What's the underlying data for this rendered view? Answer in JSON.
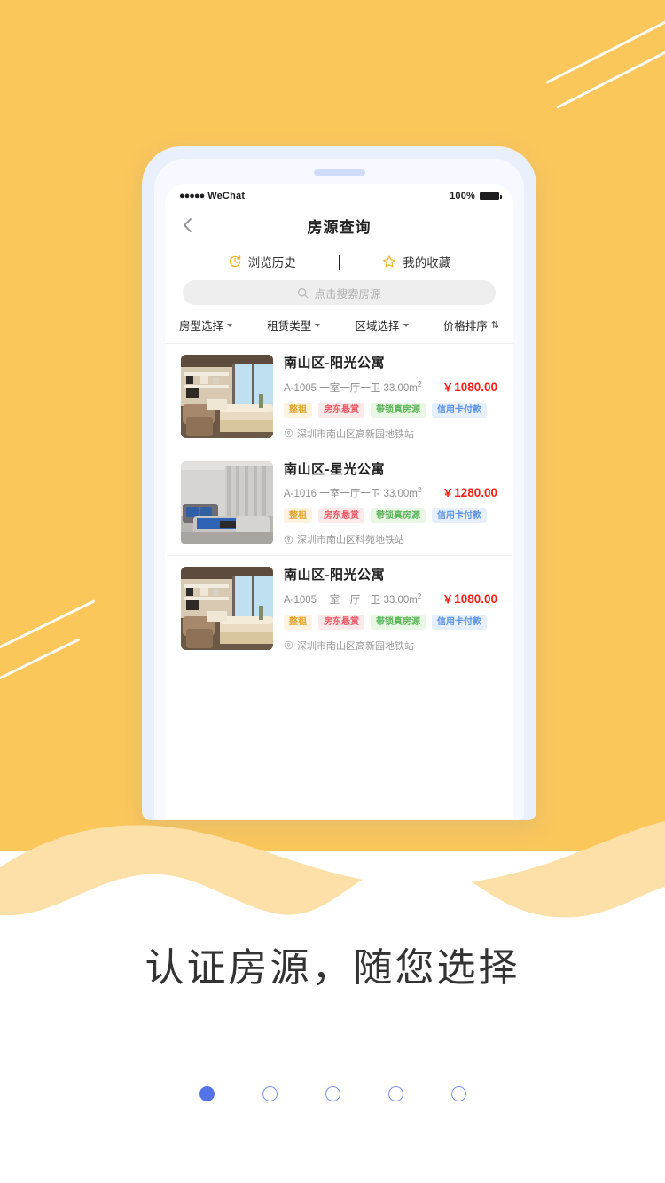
{
  "theme": {
    "hero_yellow": "#fbc75b",
    "accent_blue": "#5473e8",
    "price_red": "#fa1e17",
    "phone_frame": "#eaf0fb"
  },
  "phone": {
    "status_bar": {
      "carrier_dots": "●●●●●",
      "carrier": "WeChat",
      "battery_percent": "100%",
      "battery_icon": "battery-full-icon"
    },
    "nav": {
      "back_icon": "chevron-left-icon",
      "title": "房源查询"
    },
    "quick_tabs": [
      {
        "icon": "history-clock-icon",
        "label": "浏览历史"
      },
      {
        "icon": "star-outline-icon",
        "label": "我的收藏"
      }
    ],
    "search": {
      "icon": "search-icon",
      "placeholder": "点击搜索房源",
      "value": ""
    },
    "filters": [
      {
        "label": "房型选择",
        "icon": "chevron-down-icon"
      },
      {
        "label": "租赁类型",
        "icon": "chevron-down-icon"
      },
      {
        "label": "区域选择",
        "icon": "chevron-down-icon"
      },
      {
        "label": "价格排序",
        "icon": "sort-updown-icon",
        "glyph": "⇅"
      }
    ],
    "listings": [
      {
        "title": "南山区-阳光公寓",
        "unit": "A-1005",
        "layout": "一室一厅一卫",
        "area": "33.00",
        "area_unit": "m",
        "area_sup": "2",
        "price_symbol": "￥",
        "price": "1080.00",
        "tags": [
          "整租",
          "房东悬赏",
          "带锁真房源",
          "信用卡付款"
        ],
        "address_icon": "location-pin-icon",
        "address": "深圳市南山区高新园地铁站",
        "thumb": "room-warm-wood"
      },
      {
        "title": "南山区-星光公寓",
        "unit": "A-1016",
        "layout": "一室一厅一卫",
        "area": "33.00",
        "area_unit": "m",
        "area_sup": "2",
        "price_symbol": "￥",
        "price": "1280.00",
        "tags": [
          "整租",
          "房东悬赏",
          "带锁真房源",
          "信用卡付款"
        ],
        "address_icon": "location-pin-icon",
        "address": "深圳市南山区科苑地铁站",
        "thumb": "room-grey-blue"
      },
      {
        "title": "南山区-阳光公寓",
        "unit": "A-1005",
        "layout": "一室一厅一卫",
        "area": "33.00",
        "area_unit": "m",
        "area_sup": "2",
        "price_symbol": "￥",
        "price": "1080.00",
        "tags": [
          "整租",
          "房东悬赏",
          "带锁真房源",
          "信用卡付款"
        ],
        "address_icon": "location-pin-icon",
        "address": "深圳市南山区高新园地铁站",
        "thumb": "room-warm-wood"
      }
    ],
    "tag_styles": [
      {
        "bg": "#fdf3de",
        "fg": "#e2a530"
      },
      {
        "bg": "#fde9ea",
        "fg": "#ee5864"
      },
      {
        "bg": "#e9f7e5",
        "fg": "#5bb45a"
      },
      {
        "bg": "#e6effd",
        "fg": "#5b93e8"
      }
    ]
  },
  "caption": "认证房源，随您选择",
  "pagination": {
    "total": 5,
    "active_index": 0
  }
}
